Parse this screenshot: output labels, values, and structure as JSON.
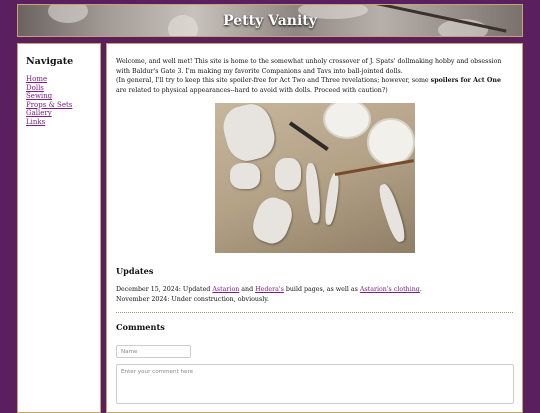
{
  "site": {
    "title": "Petty Vanity"
  },
  "sidebar": {
    "heading": "Navigate",
    "links": [
      "Home",
      "Dolls",
      "Sewing",
      "Props & Sets",
      "Gallery",
      "Links"
    ]
  },
  "intro": {
    "line1": "Welcome, and well met! This site is home to the somewhat unholy crossover of J. Spats' dollmaking hobby and obsession with Baldur's Gate 3. I'm making my favorite Companions and Tavs into ball-jointed dolls.",
    "line2_start": "(In general, I'll try to keep this site spoiler-free for Act Two and Three revelations; however, some ",
    "line2_bold": "spoilers for Act One",
    "line2_end": " are related to physical appearances--hard to avoid with dolls. Proceed with caution?)"
  },
  "updates": {
    "heading": "Updates",
    "entry1_prefix": "December 15, 2024: Updated ",
    "entry1_link1": "Astarion",
    "entry1_mid": " and ",
    "entry1_link2": "Hedera's",
    "entry1_mid2": " build pages, as well as ",
    "entry1_link3": "Astarion's clothing",
    "entry1_end": ".",
    "entry2": "November 2024: Under construction, obviously."
  },
  "comments": {
    "heading": "Comments",
    "name_placeholder": "Name",
    "comment_placeholder": "Enter your comment here"
  },
  "colors": {
    "background": "#5a1f5e",
    "link": "#7a1f86",
    "border": "#c9a46a",
    "divider": "#7fa36a"
  }
}
